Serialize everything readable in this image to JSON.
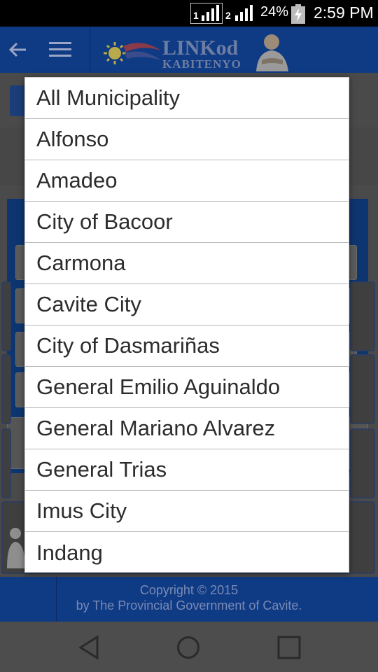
{
  "status_bar": {
    "sim1_label": "1",
    "sim2_label": "2",
    "battery_percent": "24%",
    "time": "2:59 PM"
  },
  "app_bar": {
    "logo_line1": "LINKod",
    "logo_line2": "KABITENYO"
  },
  "municipality_dialog": {
    "items": [
      "All Municipality",
      "Alfonso",
      "Amadeo",
      "City of Bacoor",
      "Carmona",
      "Cavite City",
      "City of Dasmariñas",
      "General Emilio Aguinaldo",
      "General Mariano Alvarez",
      "General Trias",
      "Imus City",
      "Indang"
    ]
  },
  "footer": {
    "line1": "Copyright © 2015",
    "line2": "by The Provincial Government of Cavite."
  },
  "colors": {
    "app_bar": "#0f3a84",
    "dialog_bg": "#ffffff",
    "dim_bg": "#4a4a4a"
  }
}
